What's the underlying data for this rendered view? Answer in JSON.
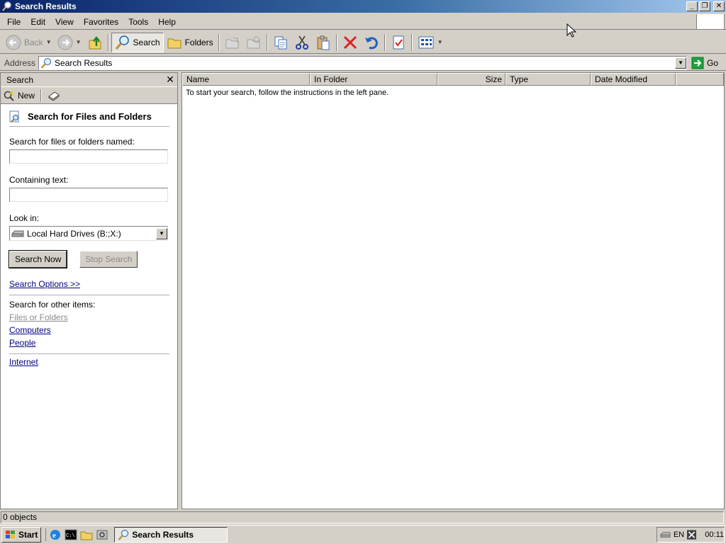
{
  "window": {
    "title": "Search Results",
    "controls": {
      "minimize": "_",
      "maximize": "❐",
      "close": "✕"
    }
  },
  "menu": [
    "File",
    "Edit",
    "View",
    "Favorites",
    "Tools",
    "Help"
  ],
  "toolbar": {
    "back": "Back",
    "search": "Search",
    "folders": "Folders"
  },
  "address": {
    "label": "Address",
    "value": "Search Results",
    "go": "Go"
  },
  "search_pane": {
    "title": "Search",
    "close": "✕",
    "new": "New",
    "heading": "Search for Files and Folders",
    "named_label": "Search for files or folders named:",
    "named_value": "",
    "containing_label": "Containing text:",
    "containing_value": "",
    "look_in_label": "Look in:",
    "look_in_value": "Local Hard Drives (B:;X:)",
    "search_now": "Search Now",
    "stop_search": "Stop Search",
    "options": "Search Options >>",
    "other_label": "Search for other items:",
    "other_items": [
      "Files or Folders",
      "Computers",
      "People"
    ],
    "internet": "Internet"
  },
  "results": {
    "columns": [
      "Name",
      "In Folder",
      "Size",
      "Type",
      "Date Modified"
    ],
    "message": "To start your search, follow the instructions in the left pane."
  },
  "status": {
    "text": "0 objects"
  },
  "taskbar": {
    "start": "Start",
    "task": "Search Results",
    "lang": "EN",
    "clock": "00:11"
  }
}
